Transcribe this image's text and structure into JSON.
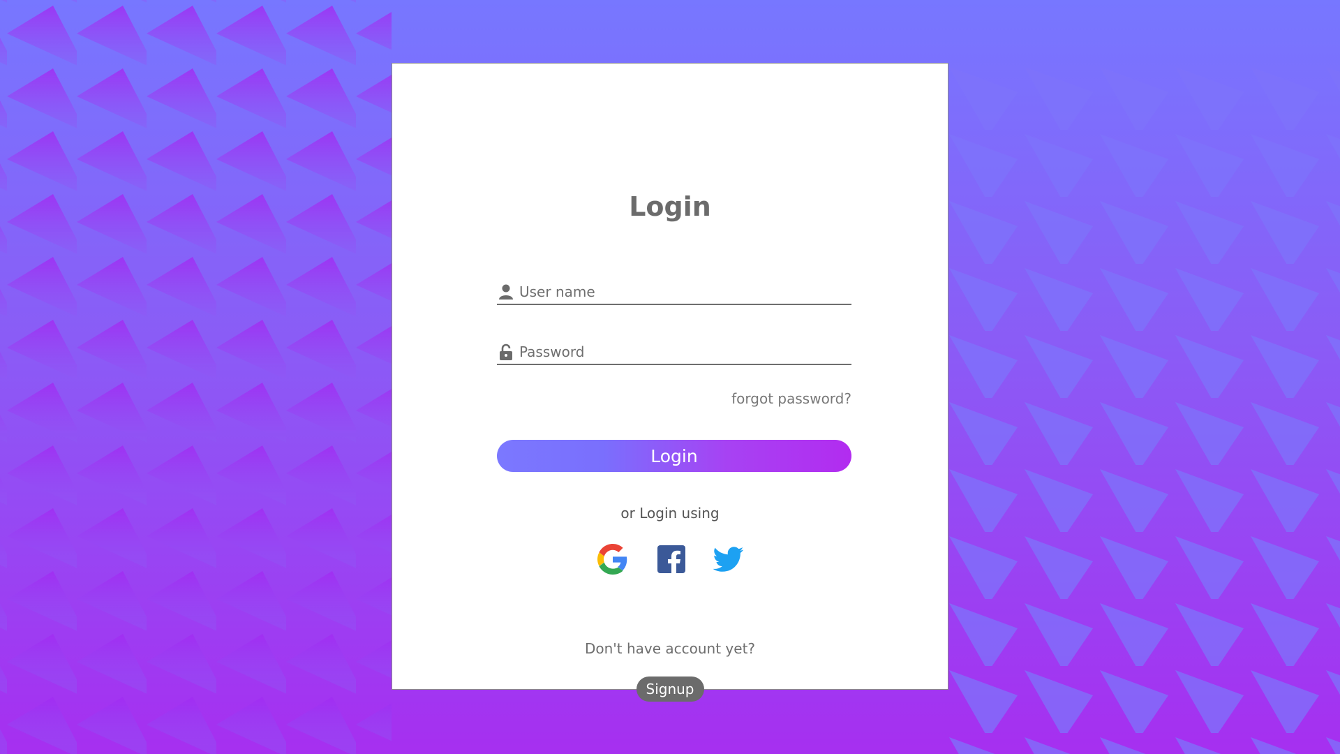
{
  "page": {
    "title": "Login"
  },
  "form": {
    "username": {
      "placeholder": "User name",
      "value": "",
      "icon": "user-icon"
    },
    "password": {
      "placeholder": "Password",
      "value": "",
      "icon": "lock-icon"
    },
    "forgot_label": "forgot password?",
    "login_label": "Login"
  },
  "social": {
    "label": "or Login using",
    "providers": [
      {
        "name": "google",
        "icon": "google-icon"
      },
      {
        "name": "facebook",
        "icon": "facebook-icon"
      },
      {
        "name": "twitter",
        "icon": "twitter-icon"
      }
    ]
  },
  "signup": {
    "prompt": "Don't have account yet?",
    "label": "Signup"
  },
  "colors": {
    "accent_start": "#7b78ff",
    "accent_end": "#b22cf0",
    "signup_bg": "#6b6b6b",
    "background_top": "#7777ff",
    "background_bottom": "#a62ff0"
  }
}
